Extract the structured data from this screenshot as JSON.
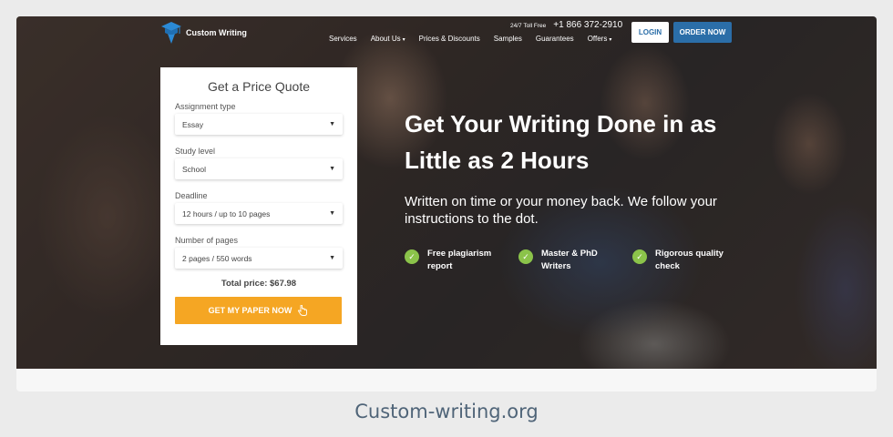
{
  "logo": {
    "text": "Custom Writing",
    "icon": "graduation-cap-icon"
  },
  "header": {
    "tollfree_label": "24/7 Toll Free",
    "phone": "+1 866 372-2910",
    "login_label": "LOGIN",
    "order_label": "ORDER NOW"
  },
  "nav": {
    "services": "Services",
    "about": "About Us",
    "prices": "Prices & Discounts",
    "samples": "Samples",
    "guarantees": "Guarantees",
    "offers": "Offers"
  },
  "quote": {
    "title": "Get a Price Quote",
    "assignment_label": "Assignment type",
    "assignment_value": "Essay",
    "study_label": "Study level",
    "study_value": "School",
    "deadline_label": "Deadline",
    "deadline_value": "12 hours / up to 10 pages",
    "pages_label": "Number of pages",
    "pages_value": "2 pages / 550 words",
    "total": "Total price: $67.98",
    "cta_label": "GET MY PAPER NOW"
  },
  "hero": {
    "headline": "Get Your Writing Done in as Little as 2 Hours",
    "subhead": "Written on time or your money back. We follow your instructions to the dot."
  },
  "features": {
    "f1": "Free plagiarism report",
    "f2": "Master & PhD Writers",
    "f3": "Rigorous quality check"
  },
  "caption": "Custom-writing.org",
  "colors": {
    "accent": "#2b6ea8",
    "cta": "#f5a623",
    "check": "#8bc34a"
  }
}
